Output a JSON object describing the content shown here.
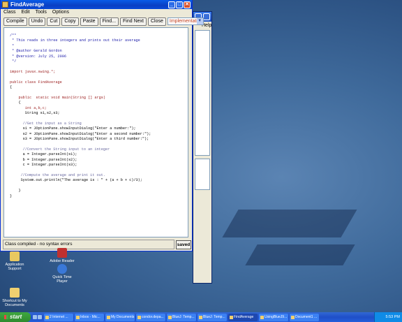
{
  "window": {
    "title": "FindAverage",
    "menu": [
      "Class",
      "Edit",
      "Tools",
      "Options"
    ],
    "toolbar": [
      "Compile",
      "Undo",
      "Cut",
      "Copy",
      "Paste",
      "Find...",
      "Find Next",
      "Close"
    ],
    "view_select": "Implementation",
    "status": "Class compiled - no syntax errors",
    "saved_label": "saved"
  },
  "code_lines": [
    {
      "text": "/**",
      "cls": "c-com"
    },
    {
      "text": " * This reads in three integers and prints out their average",
      "cls": "c-com"
    },
    {
      "text": " *",
      "cls": "c-com"
    },
    {
      "text": " * @author Gerald Gordon",
      "cls": "c-com"
    },
    {
      "text": " * @version: July 25, 2006",
      "cls": "c-com"
    },
    {
      "text": " */",
      "cls": "c-com"
    },
    {
      "text": "",
      "cls": ""
    },
    {
      "text": "import javax.swing.*;",
      "cls": "c-kw"
    },
    {
      "text": "",
      "cls": ""
    },
    {
      "text": "public class FindAverage",
      "cls": "c-kw"
    },
    {
      "text": "{",
      "cls": ""
    },
    {
      "text": "",
      "cls": ""
    },
    {
      "text": "    public  static void main(String [] args)",
      "cls": "c-kw"
    },
    {
      "text": "    {",
      "cls": ""
    },
    {
      "text": "       int a,b,c;",
      "cls": "c-kw"
    },
    {
      "text": "       String s1,s2,s3;",
      "cls": ""
    },
    {
      "text": "",
      "cls": ""
    },
    {
      "text": "      //Get the input as a String",
      "cls": "c-grey"
    },
    {
      "text": "      s1 = JOptionPane.showInputDialog(\"Enter a number:\");",
      "cls": ""
    },
    {
      "text": "      s2 = JOptionPane.showInputDialog(\"Enter a second number:\");",
      "cls": ""
    },
    {
      "text": "      s3 = JOptionPane.showInputDialog(\"Enter a third number:\");",
      "cls": ""
    },
    {
      "text": "",
      "cls": ""
    },
    {
      "text": "      //Convert the String input to an integer",
      "cls": "c-grey"
    },
    {
      "text": "      a = Integer.parseInt(s1);",
      "cls": ""
    },
    {
      "text": "      b = Integer.parseInt(s2);",
      "cls": ""
    },
    {
      "text": "      c = Integer.parseInt(s3);",
      "cls": ""
    },
    {
      "text": "",
      "cls": ""
    },
    {
      "text": "     //Compute the average and print it out.",
      "cls": "c-grey"
    },
    {
      "text": "     System.out.println(\"The average is : \" + (a + b + c)/3);",
      "cls": ""
    },
    {
      "text": "",
      "cls": ""
    },
    {
      "text": "    }",
      "cls": ""
    },
    {
      "text": "}",
      "cls": ""
    }
  ],
  "bg_window": {
    "menu": "Help"
  },
  "desktop_icons": [
    {
      "label": "Application Support"
    },
    {
      "label": "Adobe Reader"
    },
    {
      "label": "Quick Time Player"
    },
    {
      "label": "Shortcut to My Documents"
    }
  ],
  "taskbar": {
    "start": "start",
    "tasks": [
      "2 Internet ...",
      "Inbox - Mic...",
      "My Documents",
      "condor.depa...",
      "BlueJ: Temp...",
      "BlueJ: Temp...",
      "FindAverage",
      "UsingBlueJ9...",
      "Document1 ..."
    ],
    "clock": "5:53 PM"
  }
}
